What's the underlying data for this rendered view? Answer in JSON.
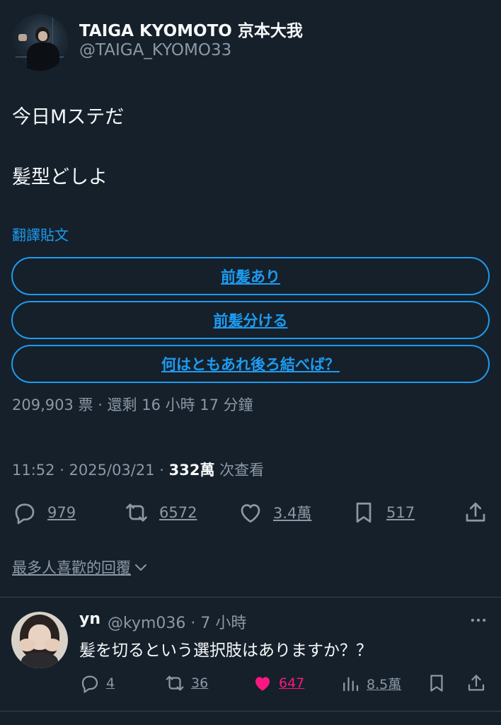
{
  "author": {
    "name": "TAIGA KYOMOTO 京本大我",
    "handle": "@TAIGA_KYOMO33"
  },
  "tweet": {
    "line1": "今日Mステだ",
    "line2": "髪型どしよ",
    "translate_label": "翻譯貼文"
  },
  "poll": {
    "options": [
      "前髪あり",
      "前髪分ける",
      "何はともあれ後ろ結べば？"
    ],
    "meta": "209,903 票 · 還剩 16 小時 17 分鐘"
  },
  "meta": {
    "time_date": "11:52 · 2025/03/21 · ",
    "views": "332萬",
    "views_label": " 次查看"
  },
  "actions": {
    "replies": "979",
    "reposts": "6572",
    "likes": "3.4萬",
    "bookmarks": "517"
  },
  "sort": {
    "label": "最多人喜歡的回覆"
  },
  "reply": {
    "name": "yn",
    "handle_time": "@kym036 · 7 小時",
    "text": "髪を切るという選択肢はありますか？？",
    "replies": "4",
    "reposts": "36",
    "likes": "647",
    "views": "8.5萬"
  },
  "colors": {
    "background": "#15202b",
    "accent": "#1d9bf0",
    "secondary_text": "#8b98a5",
    "like_pink": "#f91880"
  },
  "icons": [
    "reply-icon",
    "repost-icon",
    "heart-icon",
    "bookmark-icon",
    "share-icon",
    "chevron-down-icon",
    "more-icon",
    "views-icon"
  ]
}
